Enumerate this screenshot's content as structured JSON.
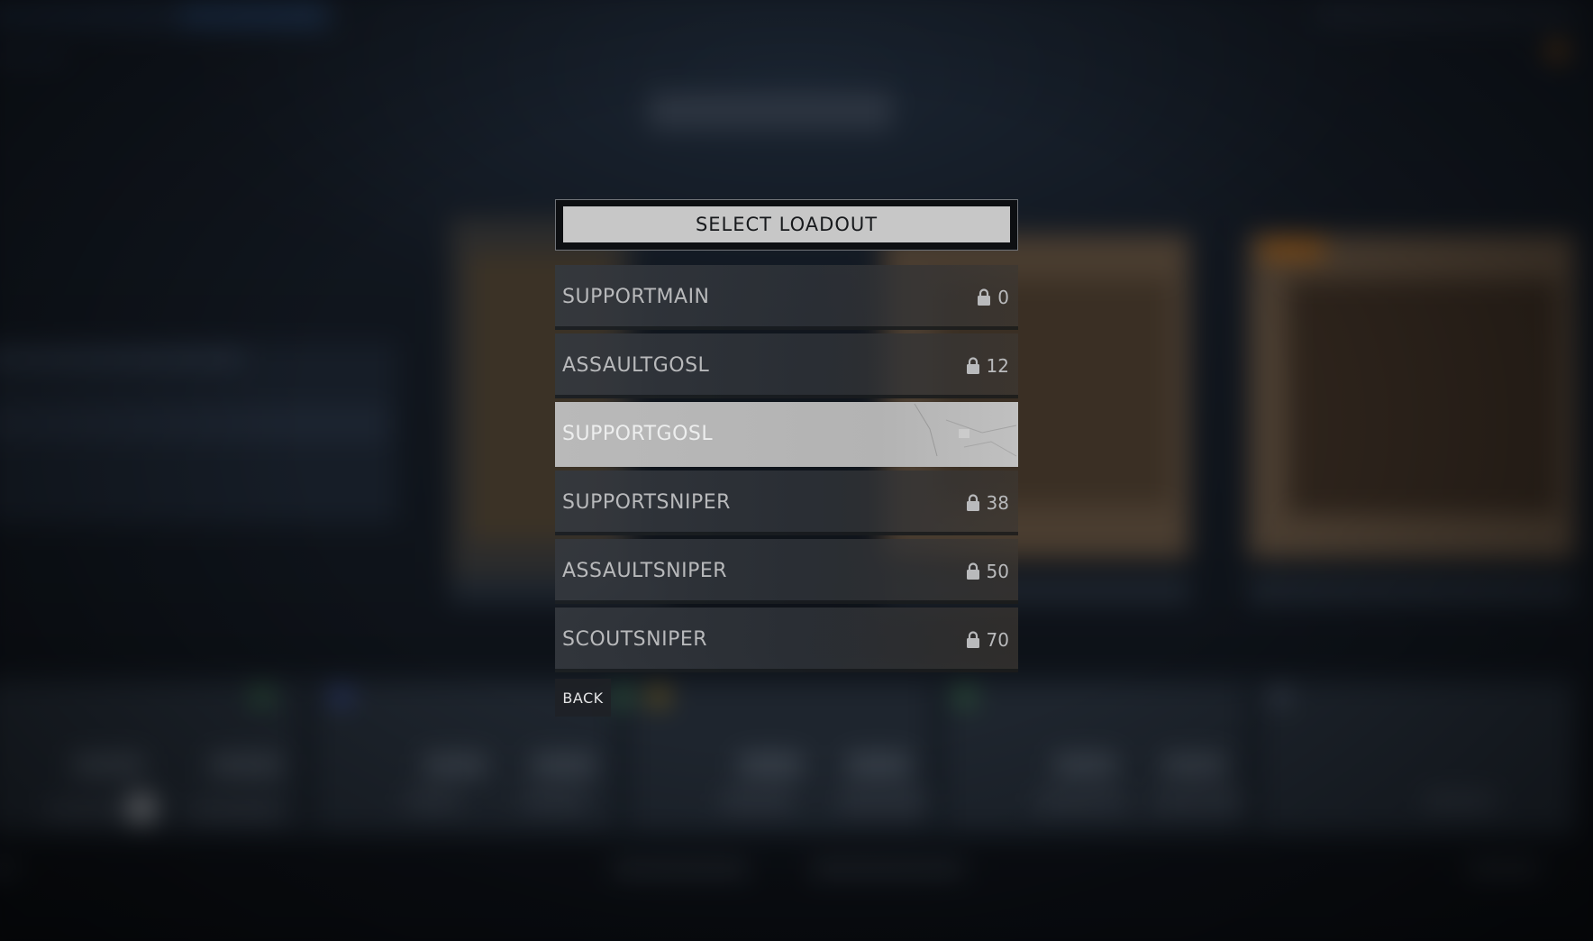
{
  "modal": {
    "title": "SELECT LOADOUT",
    "back_label": "BACK"
  },
  "loadouts": [
    {
      "name": "SUPPORTMAIN",
      "locked": true,
      "level": "0",
      "selected": false
    },
    {
      "name": "ASSAULTGOSL",
      "locked": true,
      "level": "12",
      "selected": false
    },
    {
      "name": "SUPPORTGOSL",
      "locked": false,
      "level": "",
      "selected": true
    },
    {
      "name": "SUPPORTSNIPER",
      "locked": true,
      "level": "38",
      "selected": false
    },
    {
      "name": "ASSAULTSNIPER",
      "locked": true,
      "level": "50",
      "selected": false
    },
    {
      "name": "SCOUTSNIPER",
      "locked": true,
      "level": "70",
      "selected": false
    }
  ],
  "icons": {
    "lock": "lock-icon"
  },
  "colors": {
    "selected_row": "#b9b9b9",
    "row": "#34383e",
    "header": "#c7c7c7"
  }
}
